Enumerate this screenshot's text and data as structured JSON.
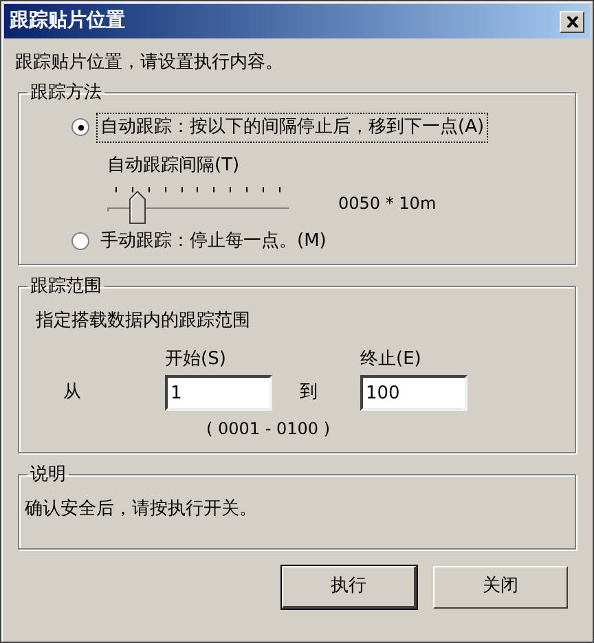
{
  "window": {
    "title": "跟踪贴片位置"
  },
  "intro": "跟踪贴片位置，请设置执行内容。",
  "method": {
    "legend": "跟踪方法",
    "options": [
      {
        "label": "自动跟踪：按以下的间隔停止后，移到下一点(A)",
        "selected": true
      },
      {
        "label": "手动跟踪：停止每一点。(M)",
        "selected": false
      }
    ],
    "interval": {
      "label": "自动跟踪间隔(T)",
      "level": 0.13,
      "reading": "0050 * 10m"
    }
  },
  "range": {
    "legend": "跟踪范围",
    "description": "指定搭载数据内的跟踪范围",
    "from_label": "从",
    "start": {
      "label": "开始(S)",
      "value": "1"
    },
    "to_label": "到",
    "end": {
      "label": "终止(E)",
      "value": "100"
    },
    "hint": "( 0001 - 0100 )"
  },
  "note": {
    "legend": "说明",
    "text": "确认安全后，请按执行开关。"
  },
  "buttons": [
    {
      "label": "执行",
      "default": true
    },
    {
      "label": "关闭",
      "default": false
    }
  ]
}
